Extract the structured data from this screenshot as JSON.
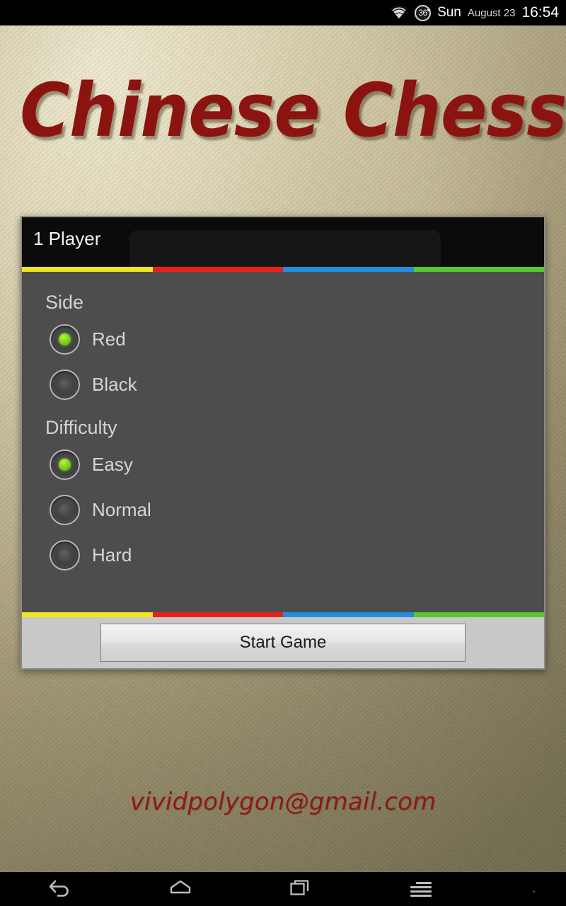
{
  "status_bar": {
    "wifi_icon": "wifi-icon",
    "battery_icon": "battery-circle-icon",
    "battery_level": "36",
    "day": "Sun",
    "date": "August 23",
    "clock": "16:54"
  },
  "wallpaper": {
    "texture": "leather-beige",
    "base_color": "#b9ae8c"
  },
  "title": {
    "text": "Chinese Chess",
    "color": "#8c1410"
  },
  "email": {
    "text": "vividpolygon@gmail.com",
    "color": "#8e1a14"
  },
  "dialog": {
    "header": {
      "title": "1 Player"
    },
    "divider_colors": [
      "#f2e61c",
      "#e8201c",
      "#1f8fe0",
      "#5ac832"
    ],
    "groups": [
      {
        "label": "Side",
        "options": [
          {
            "label": "Red",
            "selected": true
          },
          {
            "label": "Black",
            "selected": false
          }
        ]
      },
      {
        "label": "Difficulty",
        "options": [
          {
            "label": "Easy",
            "selected": true
          },
          {
            "label": "Normal",
            "selected": false
          },
          {
            "label": "Hard",
            "selected": false
          }
        ]
      }
    ],
    "footer": {
      "start_button_label": "Start Game"
    }
  },
  "nav_bar": {
    "back_icon": "back-arrow-icon",
    "home_icon": "home-icon",
    "recents_icon": "recents-icon",
    "menu_icon": "menu-icon"
  }
}
